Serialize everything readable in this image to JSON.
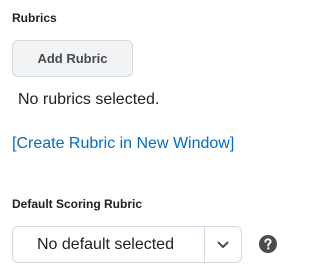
{
  "rubrics": {
    "heading": "Rubrics",
    "add_button_label": "Add Rubric",
    "empty_message": "No rubrics selected.",
    "create_link_label": "[Create Rubric in New Window]"
  },
  "default_scoring": {
    "heading": "Default Scoring Rubric",
    "selected_value": "No default selected",
    "caret_icon": "chevron-down-icon",
    "help_icon": "question-circle-icon"
  },
  "colors": {
    "link": "#006fbf",
    "button_bg": "#f1f3f5",
    "border": "#d3d9e3",
    "text": "#202122"
  }
}
